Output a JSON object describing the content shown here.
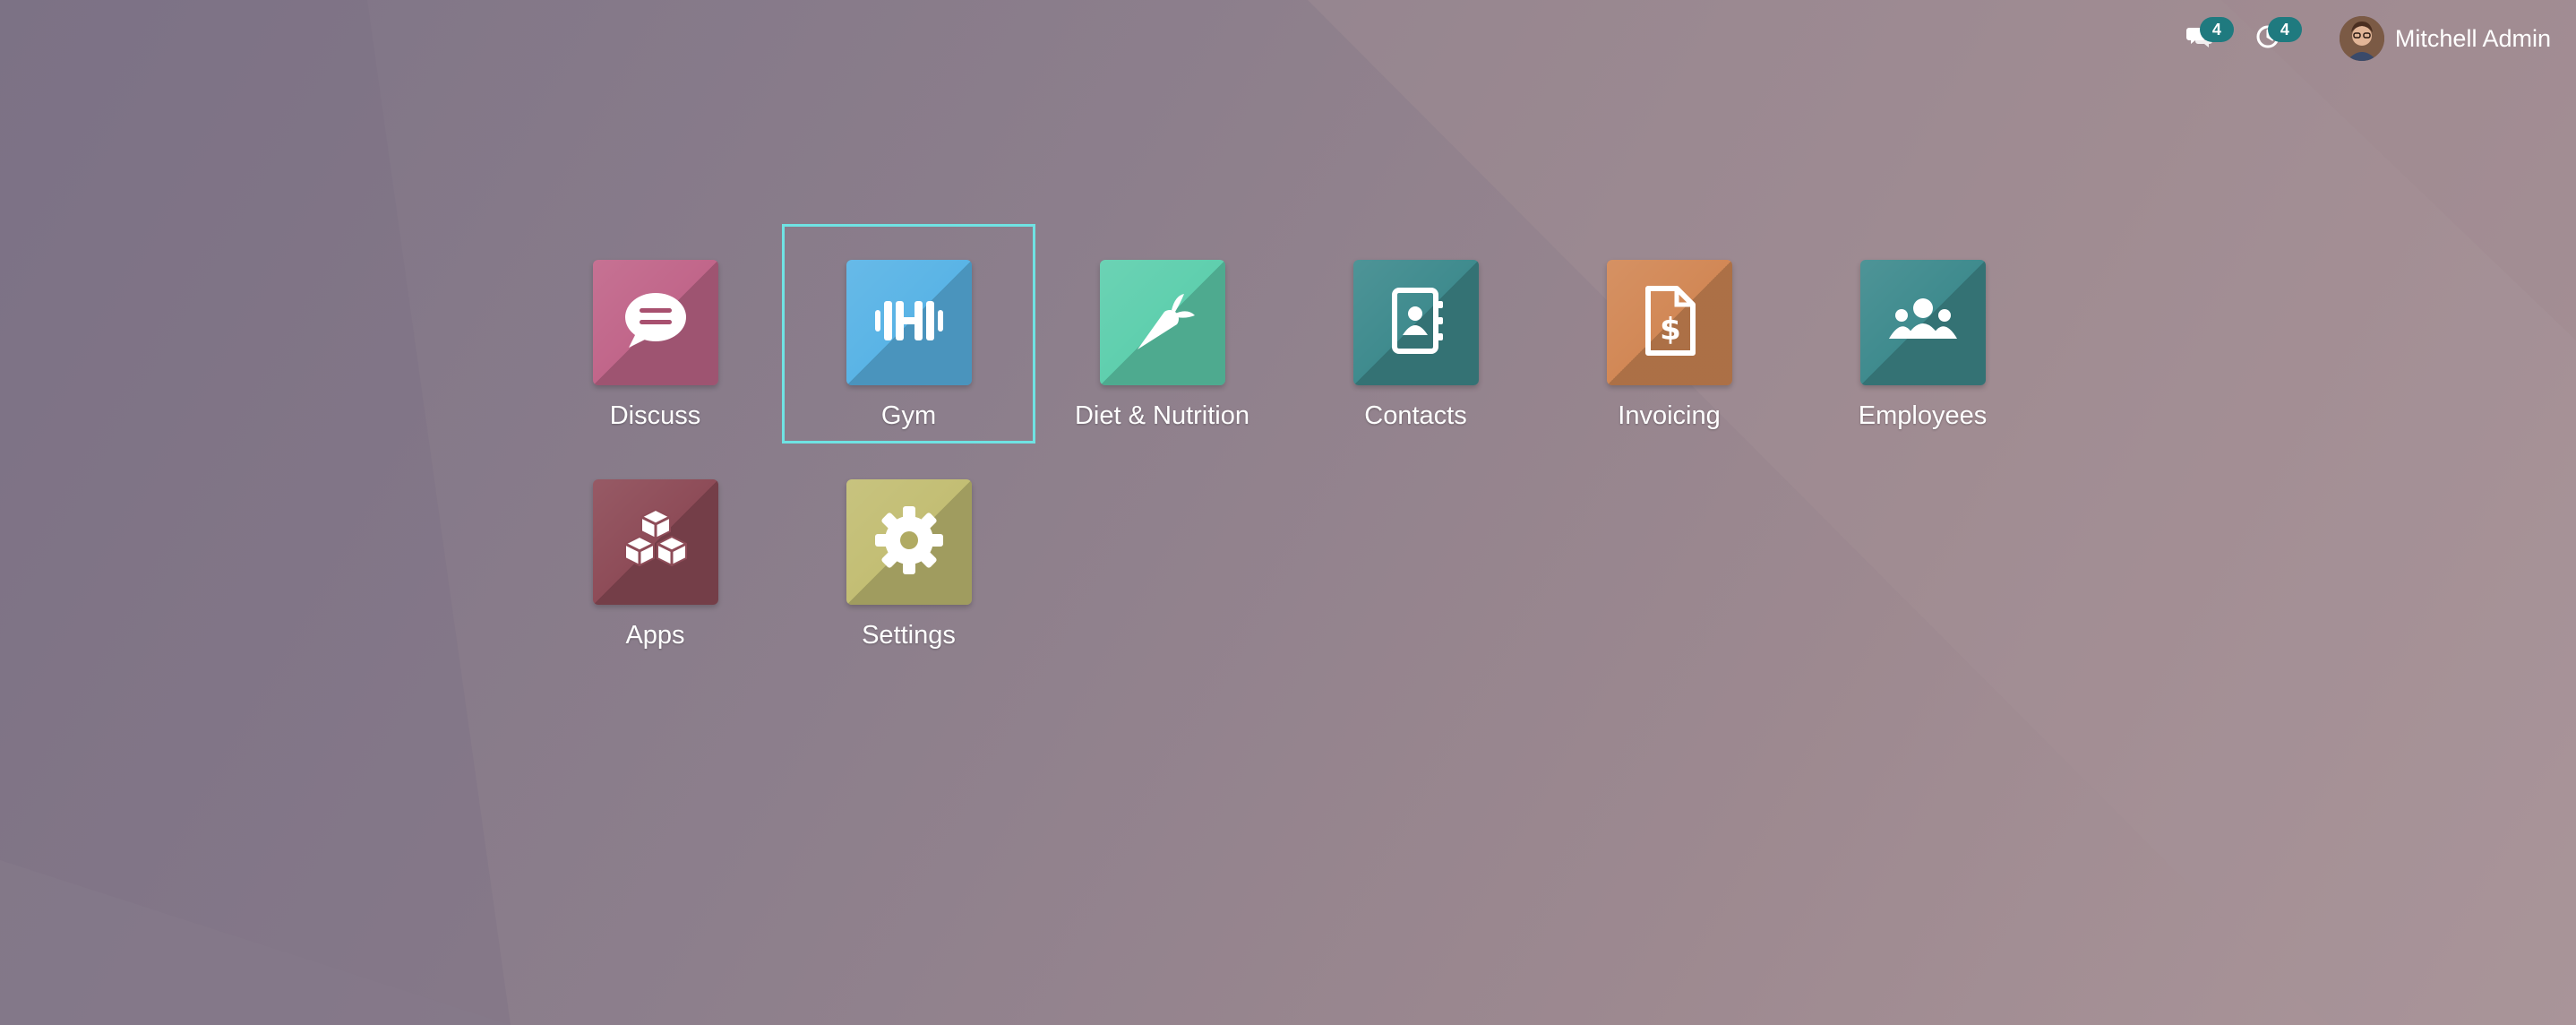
{
  "topbar": {
    "messages_icon": "chat-bubbles-icon",
    "messages_count": "4",
    "activities_icon": "clock-icon",
    "activities_count": "4",
    "user_name": "Mitchell Admin"
  },
  "apps": [
    {
      "label": "Discuss",
      "icon": "chat-bubble-icon",
      "color": "#c1668a",
      "focused": false
    },
    {
      "label": "Gym",
      "icon": "dumbbell-icon",
      "color": "#5ab4e6",
      "focused": true
    },
    {
      "label": "Diet & Nutrition",
      "icon": "carrot-icon",
      "color": "#5fcfae",
      "focused": false
    },
    {
      "label": "Contacts",
      "icon": "address-book-icon",
      "color": "#3f8b8e",
      "focused": false
    },
    {
      "label": "Invoicing",
      "icon": "invoice-dollar-icon",
      "color": "#d28856",
      "focused": false
    },
    {
      "label": "Employees",
      "icon": "users-icon",
      "color": "#3f8b8e",
      "focused": false
    },
    {
      "label": "Apps",
      "icon": "cubes-icon",
      "color": "#8e4c58",
      "focused": false
    },
    {
      "label": "Settings",
      "icon": "gear-icon",
      "color": "#c3be74",
      "focused": false
    }
  ],
  "colors": {
    "focus_outline": "#6fe3e3",
    "counter_badge": "#1f7a7f"
  }
}
